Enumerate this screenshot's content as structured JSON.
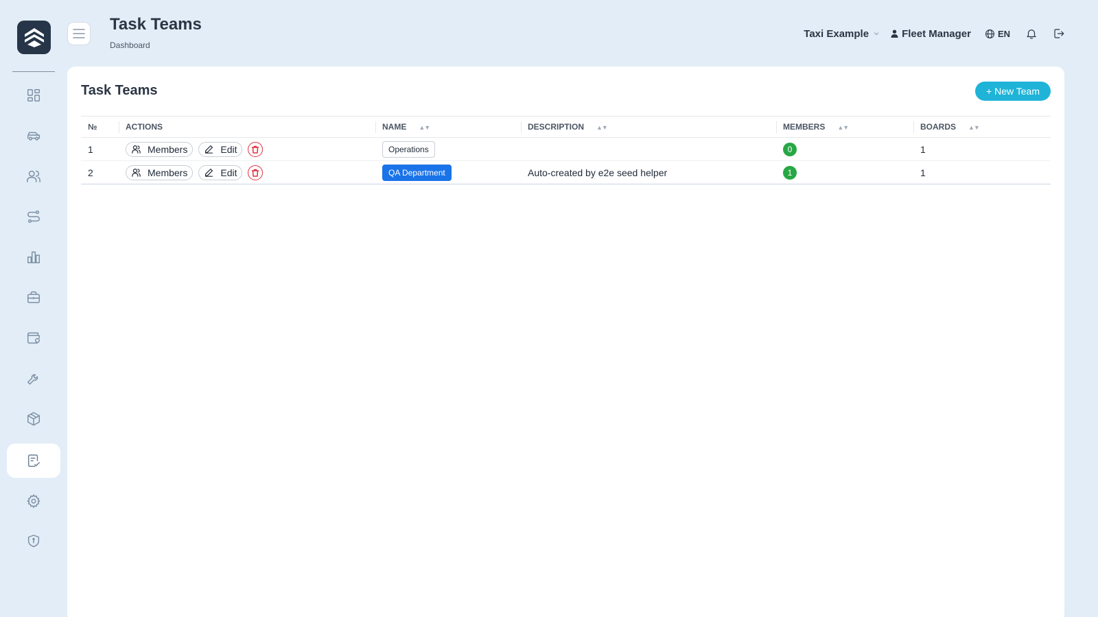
{
  "header": {
    "title": "Task Teams",
    "breadcrumb": "Dashboard",
    "company": "Taxi Example",
    "user": "Fleet Manager",
    "language": "EN"
  },
  "sidebar": {
    "items": [
      {
        "icon": "dashboard-icon",
        "active": false
      },
      {
        "icon": "car-icon",
        "active": false
      },
      {
        "icon": "users-icon",
        "active": false
      },
      {
        "icon": "route-icon",
        "active": false
      },
      {
        "icon": "chart-icon",
        "active": false
      },
      {
        "icon": "briefcase-icon",
        "active": false
      },
      {
        "icon": "wallet-icon",
        "active": false
      },
      {
        "icon": "wrench-icon",
        "active": false
      },
      {
        "icon": "package-icon",
        "active": false
      },
      {
        "icon": "task-icon",
        "active": true
      },
      {
        "icon": "gear-icon",
        "active": false
      },
      {
        "icon": "shield-icon",
        "active": false
      }
    ]
  },
  "card": {
    "title": "Task Teams",
    "new_button": "+ New Team"
  },
  "table": {
    "columns": [
      "№",
      "ACTIONS",
      "NAME",
      "DESCRIPTION",
      "MEMBERS",
      "BOARDS"
    ],
    "rows": [
      {
        "num": "1",
        "members_btn": "Members",
        "edit_btn": "Edit",
        "name": "Operations",
        "name_style": "outline",
        "description": "",
        "members": "0",
        "boards": "1"
      },
      {
        "num": "2",
        "members_btn": "Members",
        "edit_btn": "Edit",
        "name": "QA Department",
        "name_style": "blue",
        "description": "Auto-created by e2e seed helper",
        "members": "1",
        "boards": "1"
      }
    ]
  },
  "colors": {
    "accent": "#1fb3d8",
    "background": "#e3edf7",
    "danger": "#e0303f",
    "success": "#28a745",
    "tag_blue": "#1a73e8"
  }
}
